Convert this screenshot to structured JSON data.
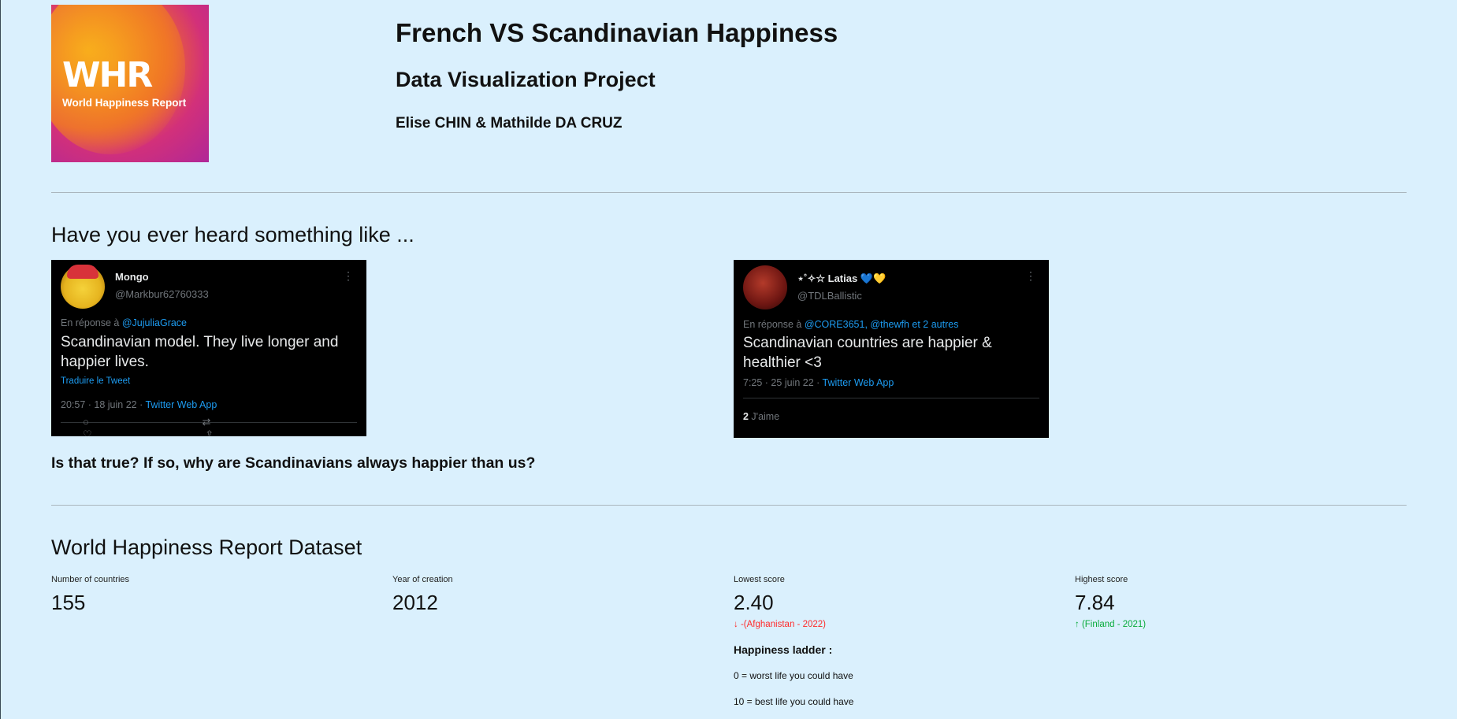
{
  "header": {
    "logo_word": "WHR",
    "logo_text": "World Happiness Report",
    "title": "French VS Scandinavian Happiness",
    "subtitle": "Data Visualization Project",
    "authors": "Elise CHIN & Mathilde DA CRUZ"
  },
  "intro": {
    "heading": "Have you ever heard something like ...",
    "question": "Is that true? If so, why are Scandinavians always happier than us?"
  },
  "tweets": [
    {
      "name": "Mongo",
      "handle": "@Markbur62760333",
      "reply_prefix": "En réponse à ",
      "reply_to": "@JujuliaGrace",
      "text": "Scandinavian model.  They live longer and happier lives.",
      "translate": "Traduire le Tweet",
      "time": "20:57 · 18 juin 22 · ",
      "source": "Twitter Web App"
    },
    {
      "name": "⋆˚✧☆ Latias 💙💛",
      "handle": "@TDLBallistic",
      "reply_prefix": "En réponse à ",
      "reply_to": "@CORE3651, @thewfh et 2 autres",
      "text": "Scandinavian countries are happier & healthier <3",
      "time": "7:25 · 25 juin 22 · ",
      "source": "Twitter Web App",
      "likes_count": "2",
      "likes_label": " J'aime"
    }
  ],
  "dataset": {
    "heading": "World Happiness Report Dataset",
    "metrics": [
      {
        "label": "Number of countries",
        "value": "155"
      },
      {
        "label": "Year of creation",
        "value": "2012"
      },
      {
        "label": "Lowest score",
        "value": "2.40",
        "delta": "-(Afghanistan - 2022)"
      },
      {
        "label": "Highest score",
        "value": "7.84",
        "delta": "(Finland - 2021)"
      }
    ],
    "ladder": {
      "title": "Happiness ladder :",
      "worst": "0 = worst life you could have",
      "best": "10 = best life you could have"
    }
  },
  "colors": {
    "background": "#daf0fd",
    "delta_down": "#ff2b2b",
    "delta_up": "#09ab3b",
    "twitter_link": "#1d9bf0"
  }
}
